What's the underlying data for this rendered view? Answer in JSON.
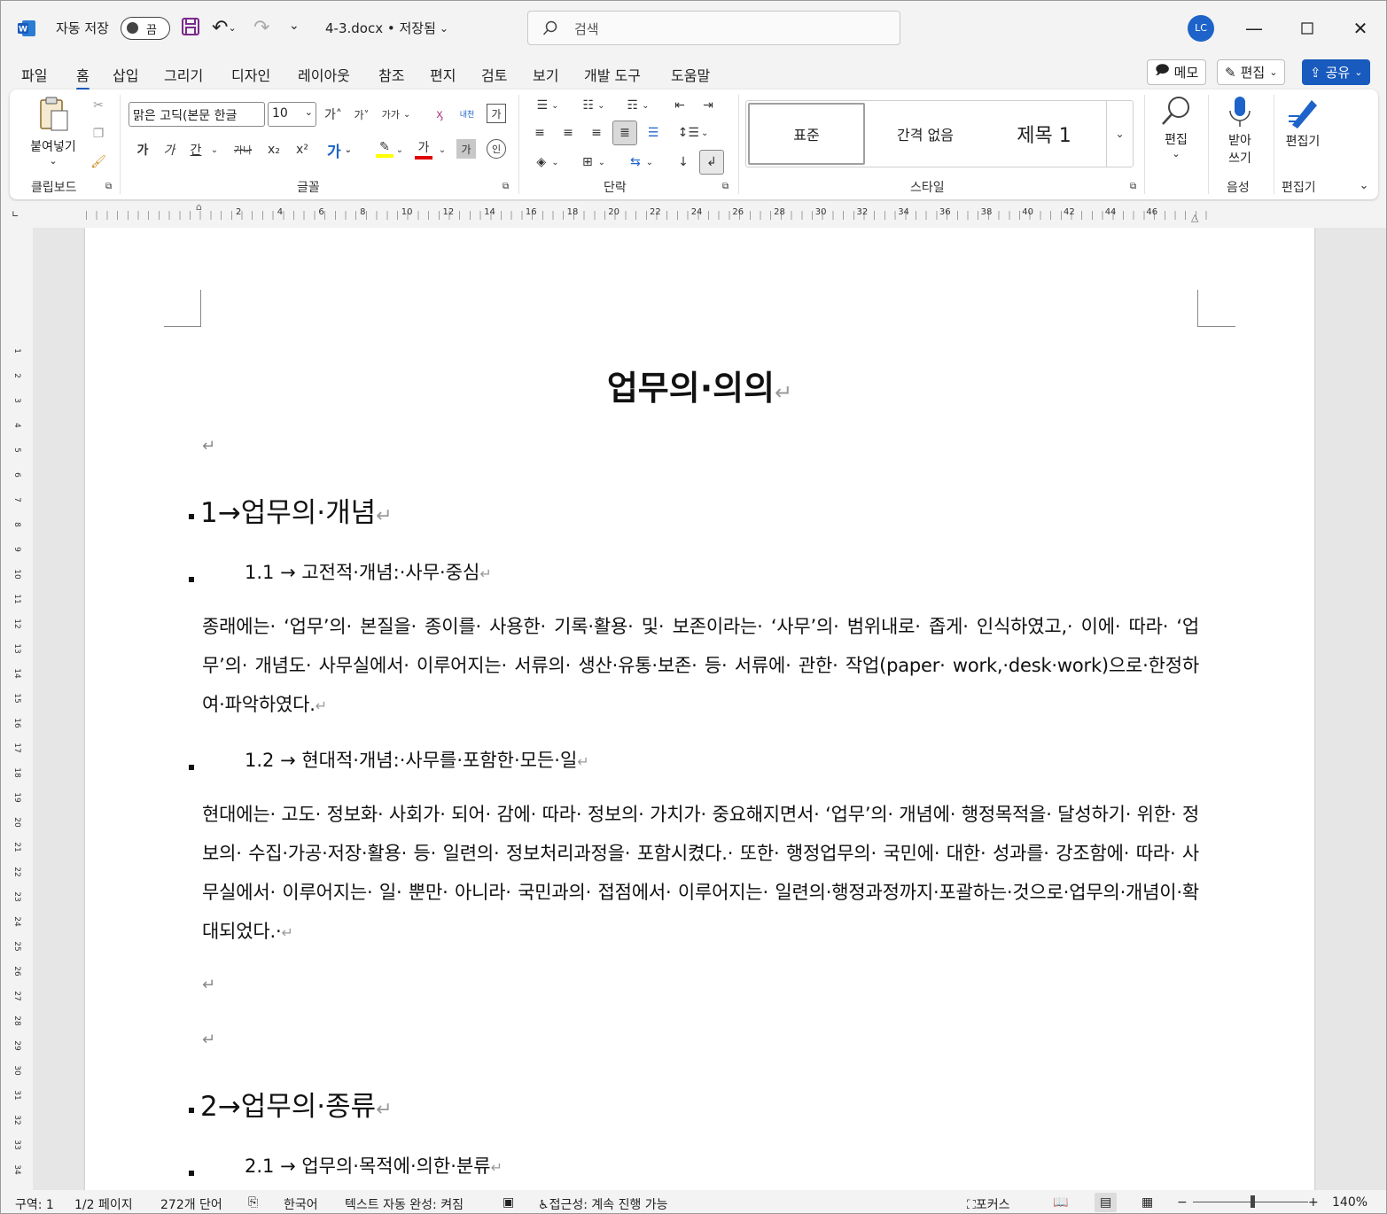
{
  "titlebar": {
    "autosave_label": "자동 저장",
    "autosave_state": "끔",
    "document_name": "4-3.docx • 저장됨",
    "search_placeholder": "검색",
    "user_initials": "LC"
  },
  "menu": {
    "tabs": [
      "파일",
      "홈",
      "삽입",
      "그리기",
      "디자인",
      "레이아웃",
      "참조",
      "편지",
      "검토",
      "보기",
      "개발 도구",
      "도움말"
    ],
    "active_tab": "홈",
    "memo_label": "메모",
    "edit_label": "편집",
    "share_label": "공유"
  },
  "ribbon": {
    "clipboard": {
      "paste_label": "붙여넣기",
      "group_label": "클립보드"
    },
    "font": {
      "font_name": "맑은 고딕(본문 한글",
      "font_size": "10",
      "group_label": "글꼴",
      "bold_glyph": "가",
      "italic_glyph": "가",
      "underline_glyph": "간",
      "strike_glyph": "가나",
      "subscript_glyph": "x₂",
      "superscript_glyph": "x²",
      "grow_glyph": "가˄",
      "shrink_glyph": "가˅",
      "case_glyph": "가가",
      "phonetic_glyph": "내천",
      "char_border_glyph": "가",
      "highlight_color": "#ffff00",
      "font_color": "#e00000"
    },
    "paragraph": {
      "group_label": "단락"
    },
    "styles": {
      "items": [
        "표준",
        "간격 없음",
        "제목 1"
      ],
      "selected": "표준",
      "group_label": "스타일"
    },
    "editing": {
      "label": "편집"
    },
    "voice": {
      "dictate_label": "받아\n쓰기",
      "group_label": "음성"
    },
    "editor": {
      "label": "편집기",
      "group_label": "편집기"
    }
  },
  "ruler": {
    "numbers": [
      "2",
      "4",
      "6",
      "8",
      "10",
      "12",
      "14",
      "16",
      "18",
      "20",
      "22",
      "24",
      "26",
      "28",
      "30",
      "32",
      "34",
      "36",
      "38",
      "40",
      "42",
      "44",
      "46"
    ]
  },
  "vruler": {
    "numbers": [
      "1",
      "2",
      "3",
      "4",
      "5",
      "6",
      "7",
      "8",
      "9",
      "10",
      "11",
      "12",
      "13",
      "14",
      "15",
      "16",
      "17",
      "18",
      "19",
      "20",
      "21",
      "22",
      "23",
      "24",
      "25",
      "26",
      "27",
      "28",
      "29",
      "30",
      "31",
      "32",
      "33",
      "34"
    ]
  },
  "document": {
    "title": "업무의·의의",
    "heading1": "1→업무의·개념",
    "heading1_1": "1.1 → 고전적·개념:·사무·중심",
    "para1": "종래에는· ‘업무’의· 본질을· 종이를· 사용한· 기록·활용· 및· 보존이라는· ‘사무’의· 범위내로· 좁게· 인식하였고,· 이에· 따라· ‘업무’의· 개념도· 사무실에서· 이루어지는· 서류의· 생산·유통·보존· 등· 서류에· 관한· 작업(paper· work,·desk·work)으로·한정하여·파악하였다.",
    "heading1_2": "1.2 → 현대적·개념:·사무를·포함한·모든·일",
    "para2": "현대에는· 고도· 정보화· 사회가· 되어· 감에· 따라· 정보의· 가치가· 중요해지면서· ‘업무’의· 개념에· 행정목적을· 달성하기· 위한· 정보의· 수집·가공·저장·활용· 등· 일련의· 정보처리과정을· 포함시켰다.· 또한· 행정업무의· 국민에· 대한· 성과를· 강조함에· 따라· 사무실에서· 이루어지는· 일· 뿐만· 아니라· 국민과의· 접점에서· 이루어지는· 일련의·행정과정까지·포괄하는·것으로·업무의·개념이·확대되었다.·",
    "heading2": "2→업무의·종류",
    "heading2_1": "2.1 → 업무의·목적에·의한·분류",
    "return_mark": "↵"
  },
  "statusbar": {
    "section": "구역: 1",
    "page": "1/2 페이지",
    "words": "272개 단어",
    "language": "한국어",
    "autocomplete": "텍스트 자동 완성: 켜짐",
    "accessibility": "접근성: 계속 진행 가능",
    "focus": "포커스",
    "zoom": "140%",
    "zoom_value": 1.4
  }
}
